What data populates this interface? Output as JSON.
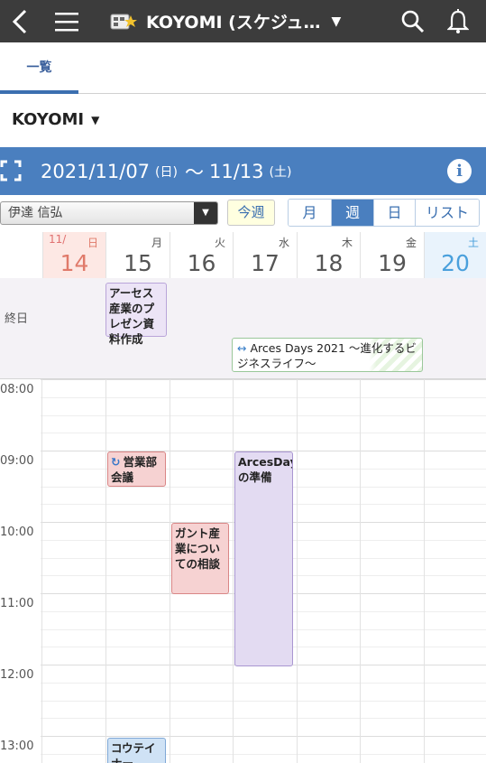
{
  "topbar": {
    "title": "KOYOMI (スケジュ…",
    "icons": [
      "back-icon",
      "menu-icon",
      "app-icon",
      "search-icon",
      "bell-icon"
    ]
  },
  "tabs": [
    {
      "label": "一覧",
      "active": true
    }
  ],
  "calendar_selector": {
    "label": "KOYOMI"
  },
  "week": {
    "start": "2021/11/07",
    "start_dow": "(日)",
    "sep": "〜",
    "end": "11/13",
    "end_dow": "(土)"
  },
  "controls": {
    "user": "伊達 信弘",
    "today": "今週",
    "views": [
      {
        "label": "月",
        "active": false
      },
      {
        "label": "週",
        "active": true
      },
      {
        "label": "日",
        "active": false
      },
      {
        "label": "リスト",
        "active": false
      }
    ]
  },
  "days": [
    {
      "month": "11/",
      "dow": "日",
      "num": "14",
      "kind": "sun"
    },
    {
      "month": "",
      "dow": "月",
      "num": "15",
      "kind": ""
    },
    {
      "month": "",
      "dow": "火",
      "num": "16",
      "kind": ""
    },
    {
      "month": "",
      "dow": "水",
      "num": "17",
      "kind": ""
    },
    {
      "month": "",
      "dow": "木",
      "num": "18",
      "kind": ""
    },
    {
      "month": "",
      "dow": "金",
      "num": "19",
      "kind": ""
    },
    {
      "month": "",
      "dow": "土",
      "num": "20",
      "kind": "sat"
    }
  ],
  "allday": {
    "label": "終日",
    "events": [
      {
        "title": "アーセス産業のプレゼン資料作成"
      },
      {
        "title": "Arces Days 2021 〜進化するビジネスライフ〜"
      }
    ]
  },
  "times": [
    "08:00",
    "09:00",
    "10:00",
    "11:00",
    "12:00",
    "13:00"
  ],
  "events": [
    {
      "title": "営業部会議",
      "repeat": true
    },
    {
      "title": "ガント産業についての相談"
    },
    {
      "title": "ArcesDaysの準備"
    },
    {
      "title": "コウテイナー"
    }
  ],
  "colors": {
    "header": "#4a7fbf",
    "topbar": "#3c3c3c"
  }
}
